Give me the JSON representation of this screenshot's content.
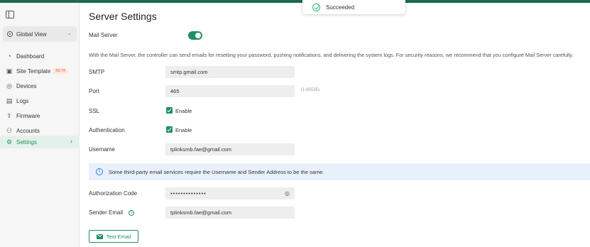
{
  "toast": {
    "message": "Succeeded"
  },
  "sidebar": {
    "site_selector": "Global View",
    "items": [
      {
        "label": "Dashboard",
        "icon": "dashboard-icon"
      },
      {
        "label": "Site Template",
        "icon": "site-template-icon",
        "badge": "BETA"
      },
      {
        "label": "Devices",
        "icon": "devices-icon"
      },
      {
        "label": "Logs",
        "icon": "logs-icon"
      },
      {
        "label": "Firmware",
        "icon": "firmware-icon"
      },
      {
        "label": "Accounts",
        "icon": "accounts-icon"
      },
      {
        "label": "Settings",
        "icon": "settings-icon",
        "active": true
      }
    ]
  },
  "page": {
    "title": "Server Settings",
    "mail_server_label": "Mail Server",
    "mail_server_enabled": true,
    "description": "With the Mail Server, the controller can send emails for resetting your password, pushing notifications, and delivering the system logs. For security reasons, we recommend that you configure Mail Server carefully.",
    "smtp": {
      "label": "SMTP",
      "value": "smtp.gmail.com"
    },
    "port": {
      "label": "Port",
      "value": "465",
      "hint": "(1-65535)"
    },
    "ssl": {
      "label": "SSL",
      "checkbox_label": "Enable",
      "checked": true
    },
    "authentication": {
      "label": "Authentication",
      "checkbox_label": "Enable",
      "checked": true
    },
    "username": {
      "label": "Username",
      "value": "tplinksmb.fae@gmail.com"
    },
    "info_banner": "Some third-party email services require the Username and Sender Address to be the same.",
    "authorization_code": {
      "label": "Authorization Code",
      "value": "••••••••••••••"
    },
    "sender_email": {
      "label": "Sender Email",
      "value": "tplinksmb.fae@gmail.com"
    },
    "test_email_button": "Test Email"
  },
  "colors": {
    "accent": "#1f8f5f",
    "topbar": "#1b6b4c",
    "info": "#2f7de1"
  }
}
